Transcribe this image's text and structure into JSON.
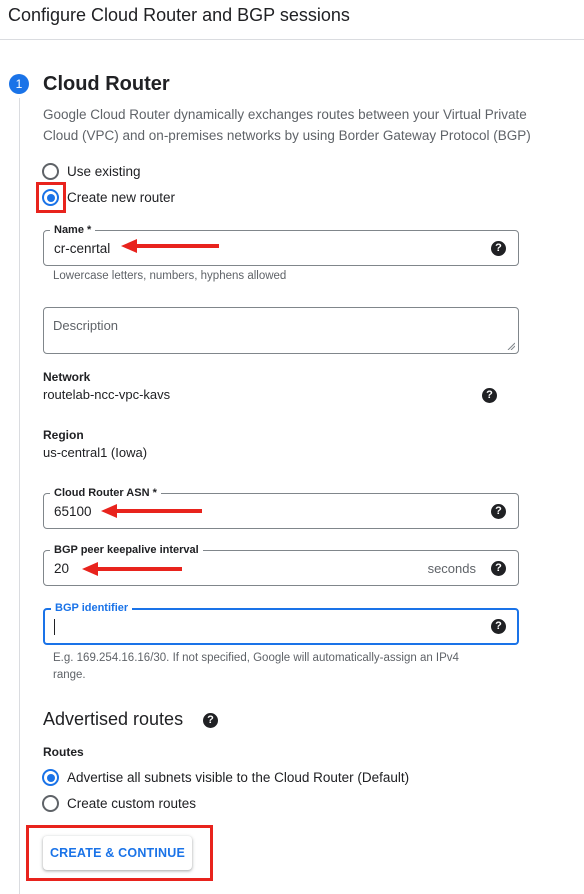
{
  "header": {
    "title": "Configure Cloud Router and BGP sessions"
  },
  "step": {
    "number": "1",
    "title": "Cloud Router",
    "description": "Google Cloud Router dynamically exchanges routes between your Virtual Private Cloud (VPC) and on-premises networks by using Border Gateway Protocol (BGP)"
  },
  "router_choice": {
    "use_existing_label": "Use existing",
    "create_new_label": "Create new router",
    "selected": "Create new router"
  },
  "name_field": {
    "label": "Name *",
    "value": "cr-cenrtal",
    "hint": "Lowercase letters, numbers, hyphens allowed"
  },
  "description_field": {
    "placeholder": "Description"
  },
  "network": {
    "label": "Network",
    "value": "routelab-ncc-vpc-kavs"
  },
  "region": {
    "label": "Region",
    "value": "us-central1 (Iowa)"
  },
  "asn_field": {
    "label": "Cloud Router ASN *",
    "value": "65100"
  },
  "keepalive_field": {
    "label": "BGP peer keepalive interval",
    "value": "20",
    "suffix": "seconds"
  },
  "bgp_identifier_field": {
    "label": "BGP identifier",
    "value": "",
    "hint": "E.g. 169.254.16.16/30. If not specified, Google will automatically-assign an IPv4 range."
  },
  "advertised": {
    "title": "Advertised routes",
    "routes_label": "Routes",
    "option_all": "Advertise all subnets visible to the Cloud Router (Default)",
    "option_custom": "Create custom routes",
    "selected": "Advertise all subnets visible to the Cloud Router (Default)"
  },
  "actions": {
    "create_continue": "CREATE & CONTINUE"
  },
  "icons": {
    "help": "help-icon",
    "radio": "radio-icon"
  },
  "colors": {
    "accent": "#1a73e8",
    "annotation": "#e8231d",
    "text": "#202124",
    "muted": "#5f6368"
  }
}
